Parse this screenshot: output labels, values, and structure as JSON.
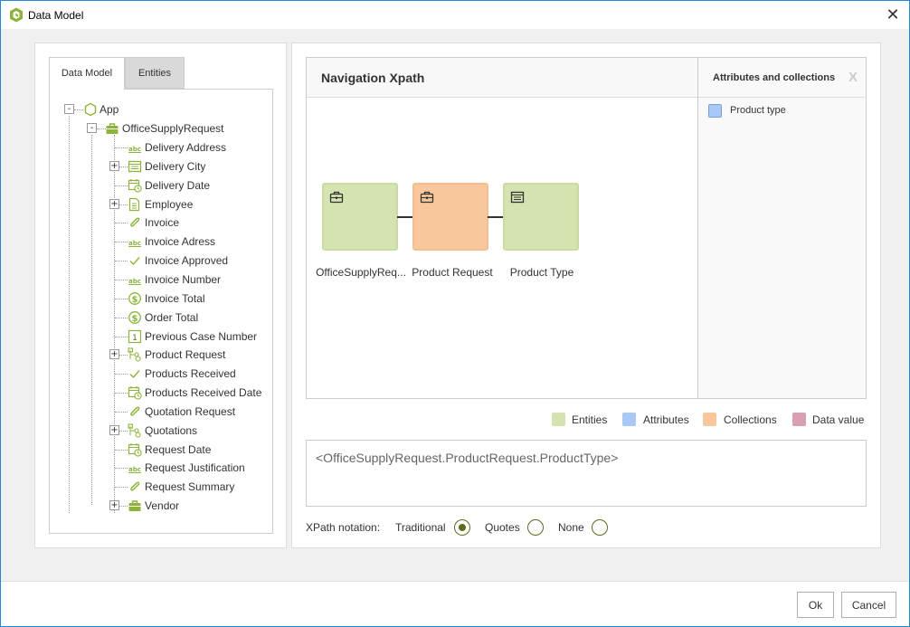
{
  "window": {
    "title": "Data Model",
    "close_symbol": "✕"
  },
  "tabs": [
    {
      "label": "Data Model",
      "active": true
    },
    {
      "label": "Entities",
      "active": false
    }
  ],
  "tree": {
    "root": {
      "label": "App",
      "expander": "-"
    },
    "entity": {
      "label": "OfficeSupplyRequest",
      "expander": "-"
    },
    "children": [
      {
        "label": "Delivery Address",
        "icon": "text-abc-icon"
      },
      {
        "label": "Delivery City",
        "icon": "table-list-icon",
        "expander": "+"
      },
      {
        "label": "Delivery Date",
        "icon": "calendar-clock-icon"
      },
      {
        "label": "Employee",
        "icon": "document-table-icon",
        "expander": "+"
      },
      {
        "label": "Invoice",
        "icon": "paperclip-icon"
      },
      {
        "label": "Invoice Adress",
        "icon": "text-abc-icon"
      },
      {
        "label": "Invoice Approved",
        "icon": "checkmark-icon"
      },
      {
        "label": "Invoice Number",
        "icon": "text-abc-icon"
      },
      {
        "label": "Invoice Total",
        "icon": "currency-icon"
      },
      {
        "label": "Order Total",
        "icon": "currency-icon"
      },
      {
        "label": "Previous Case Number",
        "icon": "number-icon"
      },
      {
        "label": "Product Request",
        "icon": "collection-icon",
        "expander": "+"
      },
      {
        "label": "Products Received",
        "icon": "checkmark-icon"
      },
      {
        "label": "Products Received Date",
        "icon": "calendar-clock-icon"
      },
      {
        "label": "Quotation Request",
        "icon": "paperclip-icon"
      },
      {
        "label": "Quotations",
        "icon": "collection-icon",
        "expander": "+"
      },
      {
        "label": "Request Date",
        "icon": "calendar-clock-icon"
      },
      {
        "label": "Request Justification",
        "icon": "text-abc-icon"
      },
      {
        "label": "Request Summary",
        "icon": "paperclip-icon"
      },
      {
        "label": "Vendor",
        "icon": "briefcase-icon",
        "expander": "+"
      }
    ]
  },
  "navigation": {
    "title": "Navigation Xpath",
    "nodes": [
      {
        "label": "OfficeSupplyReq...",
        "kind": "entity",
        "icon": "briefcase-outline-icon"
      },
      {
        "label": "Product Request",
        "kind": "collection",
        "icon": "briefcase-outline-icon"
      },
      {
        "label": "Product Type",
        "kind": "entity",
        "icon": "table-list-icon"
      }
    ]
  },
  "attributes_panel": {
    "title": "Attributes and collections",
    "close_symbol": "X",
    "items": [
      {
        "label": "Product type",
        "kind": "attribute"
      }
    ]
  },
  "legend": [
    {
      "label": "Entities",
      "color": "#d5e3b0"
    },
    {
      "label": "Attributes",
      "color": "#a8c8f5"
    },
    {
      "label": "Collections",
      "color": "#f8c89c"
    },
    {
      "label": "Data value",
      "color": "#d9a0b2"
    }
  ],
  "xpath_value": "<OfficeSupplyRequest.ProductRequest.ProductType>",
  "notation": {
    "label": "XPath notation:",
    "options": [
      {
        "label": "Traditional",
        "selected": true
      },
      {
        "label": "Quotes",
        "selected": false
      },
      {
        "label": "None",
        "selected": false
      }
    ]
  },
  "buttons": {
    "ok": "Ok",
    "cancel": "Cancel"
  },
  "colors": {
    "accent": "#8cb43c",
    "entity_fill": "#d5e3b0",
    "collection_fill": "#f8c89c",
    "attribute_fill": "#a8c8f5",
    "radio": "#5a6b1e"
  }
}
